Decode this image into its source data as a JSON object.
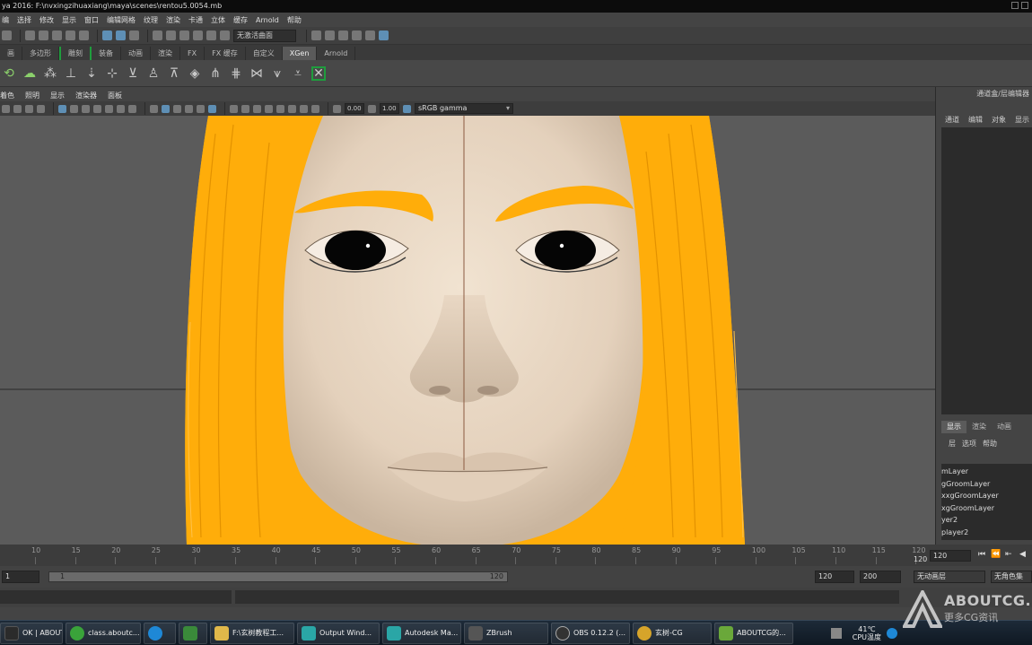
{
  "window": {
    "title": "ya 2016: F:\\nvxingzihuaxiang\\maya\\scenes\\rentou5.0054.mb"
  },
  "menubar": [
    "编",
    "选择",
    "修改",
    "显示",
    "窗口",
    "网格",
    "编辑网格",
    "网格/着色",
    "纹理",
    "渲染",
    "卡通",
    "立体",
    "缓存",
    "Arnold",
    "帮助"
  ],
  "status": {
    "object_combo": "无激活曲面"
  },
  "shelf_tabs": [
    {
      "label": "画",
      "active": false
    },
    {
      "label": "多边形",
      "active": false
    },
    {
      "label": "雕刻",
      "active": false
    },
    {
      "label": "装备",
      "active": false
    },
    {
      "label": "动画",
      "active": false
    },
    {
      "label": "渲染",
      "active": false
    },
    {
      "label": "FX",
      "active": false
    },
    {
      "label": "FX 缓存",
      "active": false
    },
    {
      "label": "自定义",
      "active": false
    },
    {
      "label": "XGen",
      "active": true
    },
    {
      "label": "Arnold",
      "active": false
    }
  ],
  "viewport_menu": [
    "着色",
    "照明",
    "显示",
    "渲染器",
    "面板"
  ],
  "viewport_toolbar": {
    "exposure": "0.00",
    "gamma_value": "1.00",
    "color_space": "sRGB gamma"
  },
  "channel_box": {
    "title": "通道盒/层编辑器",
    "menu": [
      "通道",
      "编辑",
      "对象",
      "显示"
    ],
    "layer_tabs": [
      {
        "label": "显示",
        "active": true
      },
      {
        "label": "渲染",
        "active": false
      },
      {
        "label": "动画",
        "active": false
      }
    ],
    "layer_menu": [
      "层",
      "选项",
      "帮助"
    ],
    "layers": [
      "mLayer",
      "gGroomLayer",
      "xxgGroomLayer",
      "xgGroomLayer",
      "yer2",
      "player2"
    ]
  },
  "timeline": {
    "ticks": [
      "10",
      "15",
      "20",
      "25",
      "30",
      "35",
      "40",
      "45",
      "50",
      "55",
      "60",
      "65",
      "70",
      "75",
      "80",
      "85",
      "90",
      "95",
      "100",
      "105",
      "110",
      "115",
      "120"
    ],
    "current_frame": "120",
    "end_marker": "120"
  },
  "range": {
    "start": "1",
    "inner_start": "1",
    "inner_end": "120",
    "end": "120",
    "max": "200",
    "anim_layer": "无动画层",
    "char_set": "无角色集"
  },
  "taskbar": {
    "items": [
      {
        "label": "OK | ABOUT...",
        "color": "#2b2b2b"
      },
      {
        "label": "class.aboutc...",
        "color": "#3aa33a"
      },
      {
        "label": "",
        "color": "#1e88d6"
      },
      {
        "label": "",
        "color": "#3a8a3a"
      },
      {
        "label": "F:\\玄树教程工...",
        "color": "#e0b84a"
      },
      {
        "label": "Output Wind...",
        "color": "#2aa6a6"
      },
      {
        "label": "Autodesk Ma...",
        "color": "#2aa6a6"
      },
      {
        "label": "ZBrush",
        "color": "#555555"
      },
      {
        "label": "OBS 0.12.2 (...",
        "color": "#333333"
      },
      {
        "label": "玄树-CG",
        "color": "#d6a42a"
      },
      {
        "label": "ABOUTCG的...",
        "color": "#6aa83a"
      }
    ],
    "temp": "41℃",
    "cpu": "CPU温度"
  },
  "watermark": {
    "brand": "ABOUTCG.",
    "slogan": "更多CG资讯"
  },
  "colors": {
    "hair": "#ffad0a",
    "skin": "#ead9c6",
    "viewport_bg": "#5b5b5b",
    "active_tab": "#5a5a5a"
  }
}
